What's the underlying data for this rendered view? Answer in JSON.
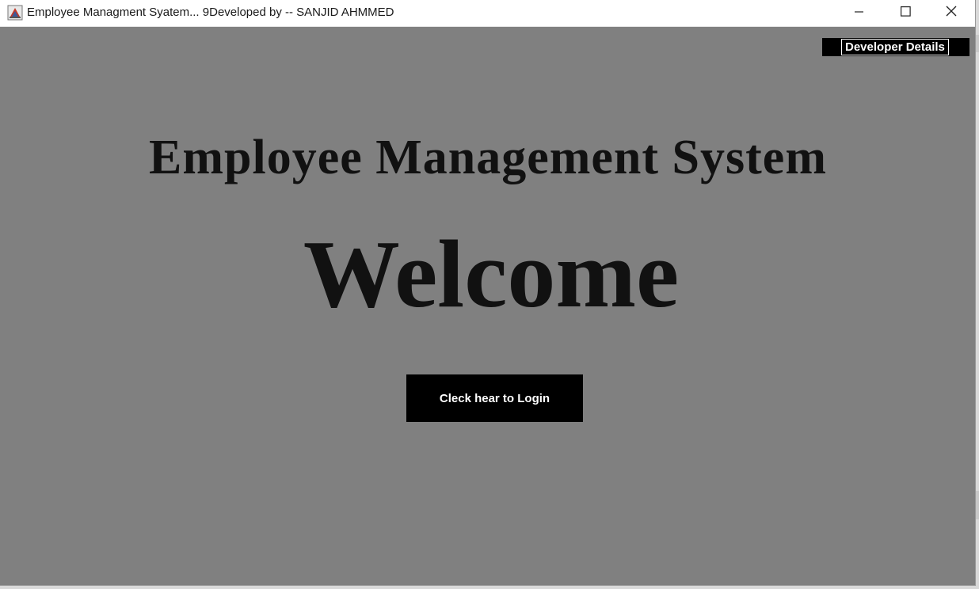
{
  "window": {
    "title": "Employee Managment Syatem... 9Developed by -- SANJID AHMMED",
    "icon": "java-app-icon",
    "controls": {
      "minimize_icon": "minimize-icon",
      "maximize_icon": "maximize-icon",
      "close_icon": "close-icon"
    }
  },
  "main": {
    "developer_button_label": "Developer Details",
    "heading": "Employee Management System",
    "welcome": "Welcome",
    "login_button_label": "Cleck hear to Login"
  },
  "colors": {
    "background": "#808080",
    "button_bg": "#000000",
    "button_text": "#ffffff",
    "heading_text": "#111111"
  }
}
